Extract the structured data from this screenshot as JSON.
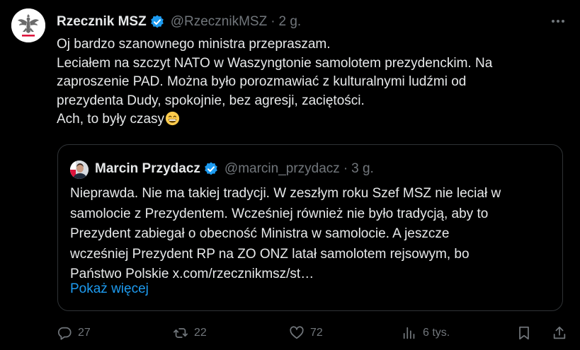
{
  "tweet": {
    "author_name": "Rzecznik MSZ",
    "author_handle": "@RzecznikMSZ",
    "separator": "·",
    "time": "2 g.",
    "lines": [
      "Oj bardzo szanownego ministra przepraszam.",
      "Leciałem na szczyt NATO w Waszyngtonie samolotem prezydenckim. Na",
      "zaproszenie PAD. Można było porozmawiać z kulturalnymi ludźmi od",
      "prezydenta Dudy, spokojnie, bez agresji, zaciętości.",
      "Ach, to były czasy"
    ]
  },
  "quote": {
    "author_name": "Marcin Przydacz",
    "author_handle": "@marcin_przydacz",
    "separator": "·",
    "time": "3 g.",
    "lines": [
      "Nieprawda. Nie ma takiej tradycji. W zeszłym roku Szef MSZ nie leciał w",
      "samolocie z Prezydentem. Wcześniej również nie było tradycją, aby to",
      "Prezydent zabiegał o obecność Ministra w samolocie. A jeszcze",
      "wcześniej Prezydent RP na ZO ONZ latał samolotem rejsowym, bo",
      "Państwo Polskie x.com/rzecznikmsz/st…"
    ],
    "show_more": "Pokaż więcej"
  },
  "actions": {
    "replies": "27",
    "reposts": "22",
    "likes": "72",
    "views": "6 tys."
  },
  "colors": {
    "background": "#000000",
    "text": "#e7e9ea",
    "muted": "#71767b",
    "link": "#1d9bf0",
    "border": "#2f3336",
    "verified": "#1d9bf0"
  },
  "icons": [
    "eagle-emblem-icon",
    "verified-badge-icon",
    "more-icon",
    "grinning-emoji-icon",
    "reply-icon",
    "repost-icon",
    "like-icon",
    "views-icon",
    "bookmark-icon",
    "share-icon"
  ]
}
